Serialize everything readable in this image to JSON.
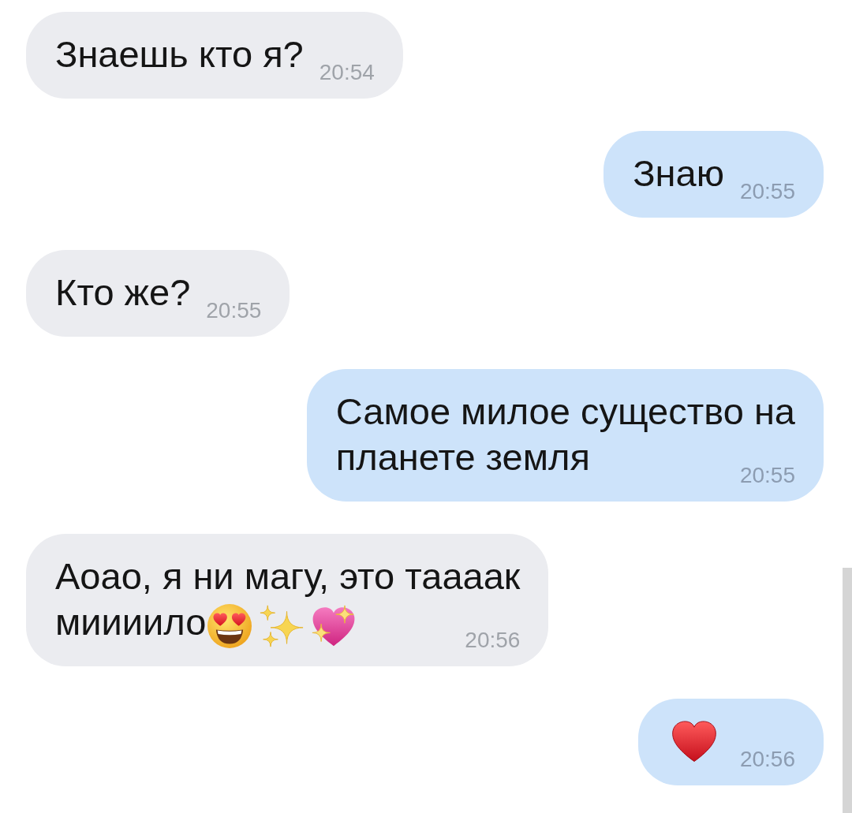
{
  "messages": [
    {
      "kind": "incoming",
      "lines": [
        "Знаешь кто я?"
      ],
      "time": "20:54"
    },
    {
      "kind": "outgoing",
      "lines": [
        "Знаю"
      ],
      "time": "20:55"
    },
    {
      "kind": "incoming",
      "lines": [
        "Кто же?"
      ],
      "time": "20:55"
    },
    {
      "kind": "outgoing",
      "lines": [
        "Самое милое существо на",
        "планете земля"
      ],
      "time": "20:55"
    },
    {
      "kind": "incoming",
      "lines": [
        "Аоао, я ни магу, это таааак",
        "миииило"
      ],
      "emoji": [
        {
          "kind": "hearteyes"
        },
        {
          "kind": "sparkles"
        },
        {
          "kind": "sparkleheart"
        }
      ],
      "time": "20:56"
    },
    {
      "kind": "outgoing",
      "emoji": [
        {
          "kind": "heart"
        }
      ],
      "time": "20:56"
    }
  ]
}
